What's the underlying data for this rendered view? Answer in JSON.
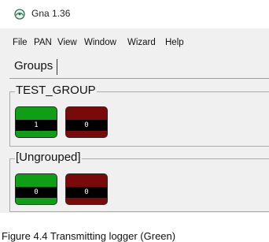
{
  "window": {
    "title": "Gna 1.36",
    "icon": "gna-app-icon"
  },
  "menu": [
    "File",
    "PAN",
    "View",
    "Window",
    "Wizard",
    "Help"
  ],
  "tabs": [
    {
      "label": "Groups",
      "active": true
    }
  ],
  "groups": [
    {
      "title": "TEST_GROUP",
      "loggers": [
        {
          "status": "transmitting",
          "color": "#0e9f17",
          "count": "1"
        },
        {
          "status": "idle",
          "color": "#7a0a0a",
          "count": "0"
        }
      ]
    },
    {
      "title": "[Ungrouped]",
      "loggers": [
        {
          "status": "transmitting",
          "color": "#0e9f17",
          "count": "0"
        },
        {
          "status": "idle",
          "color": "#7a0a0a",
          "count": "0"
        }
      ]
    }
  ],
  "caption": "Figure 4.4 Transmitting logger (Green)"
}
